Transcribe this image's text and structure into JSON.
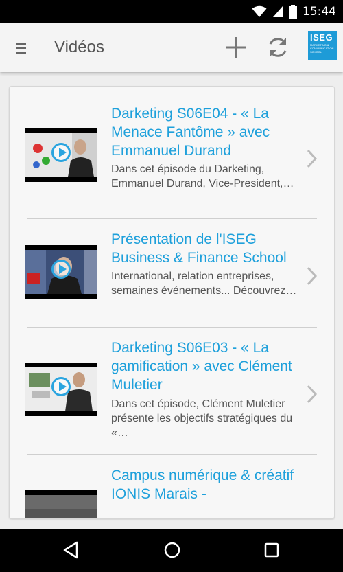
{
  "status_bar": {
    "time": "15:44"
  },
  "app_bar": {
    "title": "Vidéos",
    "logo": {
      "main": "ISEG",
      "sub": "MARKETING & COMMUNICATION SCHOOL"
    }
  },
  "videos": [
    {
      "title": "Darketing S06E04 - « La Menace Fantôme » avec Emmanuel Durand",
      "description": "Dans cet épisode du Darketing, Emmanuel Durand, Vice-President,…"
    },
    {
      "title": "Présentation de l'ISEG Business & Finance School",
      "description": "International, relation entreprises, semaines événements... Découvrez…"
    },
    {
      "title": "Darketing S06E03 - « La gamification » avec Clément Muletier",
      "description": "Dans cet épisode, Clément Muletier présente les objectifs stratégiques du «…"
    },
    {
      "title": "Campus numérique & créatif IONIS Marais -",
      "description": ""
    }
  ],
  "colors": {
    "accent": "#1ea0db",
    "app_bar_bg": "#f4f4f4",
    "status_bar_bg": "#000000",
    "logo_bg": "#1e9bd7"
  },
  "icons": [
    "menu-icon",
    "add-icon",
    "refresh-icon",
    "chevron-right-icon",
    "play-icon",
    "back-icon",
    "home-icon",
    "recents-icon",
    "wifi-icon",
    "signal-icon",
    "battery-icon"
  ]
}
